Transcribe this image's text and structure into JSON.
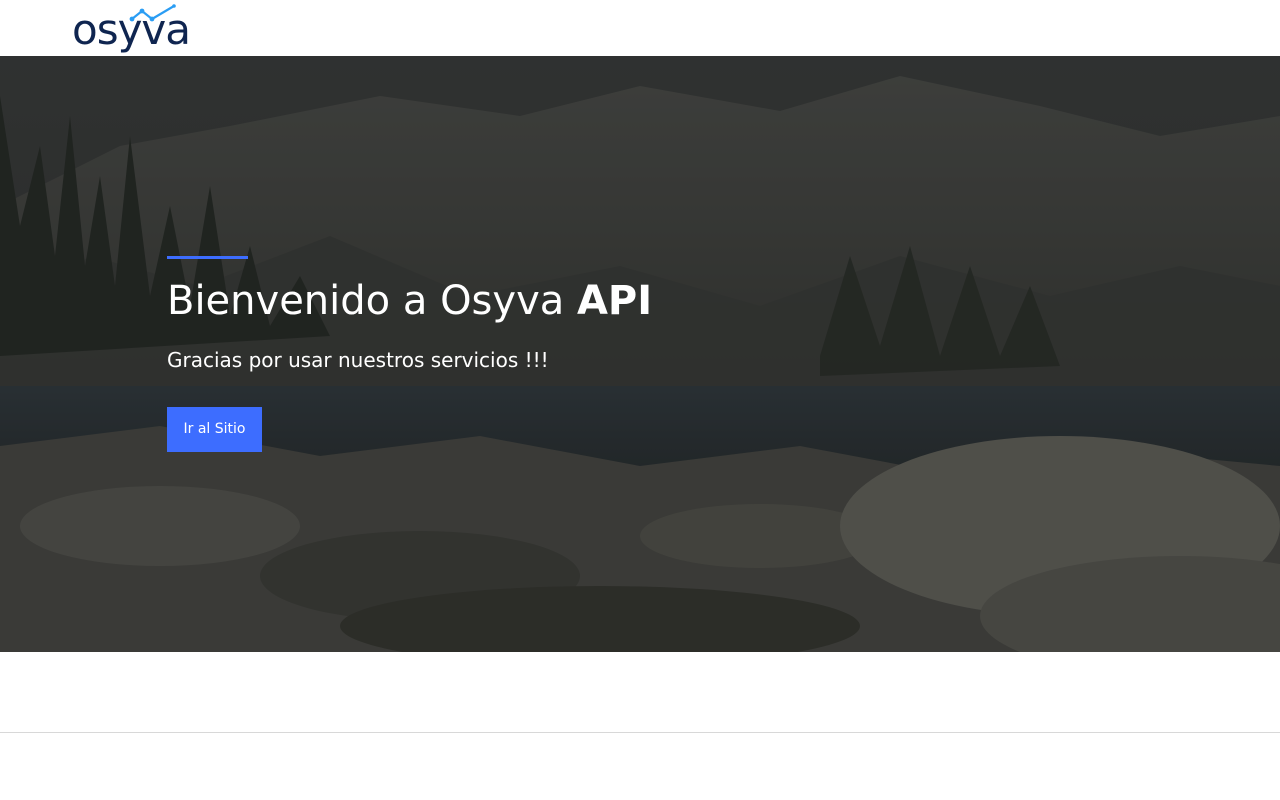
{
  "brand": {
    "name": "osyva",
    "text_color": "#0f2550",
    "accent_color": "#2a9df4"
  },
  "hero": {
    "title_regular": "Bienvenido a Osyva ",
    "title_bold": "API",
    "subtitle": "Gracias por usar nuestros servicios !!!",
    "button_label": "Ir al Sitio",
    "accent_color": "#3d6dff",
    "background": "mountain-lake-photo"
  }
}
